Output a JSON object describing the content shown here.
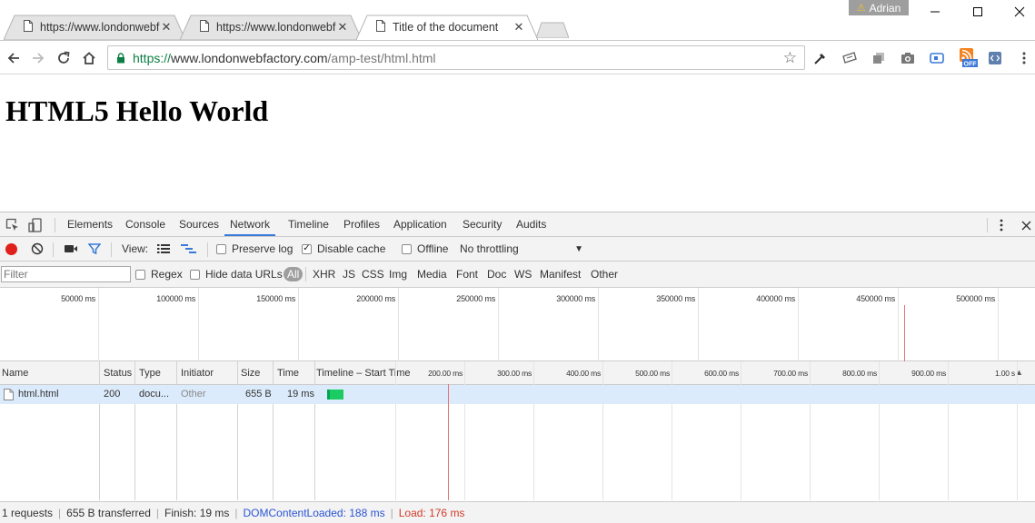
{
  "browser": {
    "tabs": [
      {
        "title": "https://www.londonwebf",
        "active": false
      },
      {
        "title": "https://www.londonwebf",
        "active": false
      },
      {
        "title": "Title of the document",
        "active": true
      }
    ],
    "profile_name": "Adrian",
    "url": {
      "scheme": "https://",
      "host": "www.londonwebfactory.com",
      "path": "/amp-test/html.html"
    },
    "extension_badge": "OFF"
  },
  "page": {
    "heading": "HTML5 Hello World"
  },
  "devtools": {
    "tabs": [
      "Elements",
      "Console",
      "Sources",
      "Network",
      "Timeline",
      "Profiles",
      "Application",
      "Security",
      "Audits"
    ],
    "selected_tab": "Network",
    "toolbar": {
      "view_label": "View:",
      "preserve_log": "Preserve log",
      "disable_cache": "Disable cache",
      "offline": "Offline",
      "throttling": "No throttling"
    },
    "filter": {
      "placeholder": "Filter",
      "regex": "Regex",
      "hide_data_urls": "Hide data URLs",
      "types": [
        "All",
        "XHR",
        "JS",
        "CSS",
        "Img",
        "Media",
        "Font",
        "Doc",
        "WS",
        "Manifest",
        "Other"
      ],
      "selected_type": "All"
    },
    "overview_ticks": [
      "50000 ms",
      "100000 ms",
      "150000 ms",
      "200000 ms",
      "250000 ms",
      "300000 ms",
      "350000 ms",
      "400000 ms",
      "450000 ms",
      "500000 ms"
    ],
    "columns": [
      "Name",
      "Status",
      "Type",
      "Initiator",
      "Size",
      "Time",
      "Timeline – Start Time"
    ],
    "waterfall_ticks": [
      "200.00 ms",
      "300.00 ms",
      "400.00 ms",
      "500.00 ms",
      "600.00 ms",
      "700.00 ms",
      "800.00 ms",
      "900.00 ms",
      "1.00 s"
    ],
    "requests": [
      {
        "name": "html.html",
        "status": "200",
        "type": "docu...",
        "initiator": "Other",
        "size": "655 B",
        "time": "19 ms"
      }
    ],
    "status": {
      "requests": "1 requests",
      "transferred": "655 B transferred",
      "finish": "Finish: 19 ms",
      "dom_content_loaded": "DOMContentLoaded: 188 ms",
      "load": "Load: 176 ms"
    },
    "colors": {
      "dom_content_loaded": "#2a55d3",
      "load": "#d23a2a",
      "selected_row": "#dcebfb",
      "record": "#e0201b",
      "tab_underline": "#3879d9"
    }
  }
}
